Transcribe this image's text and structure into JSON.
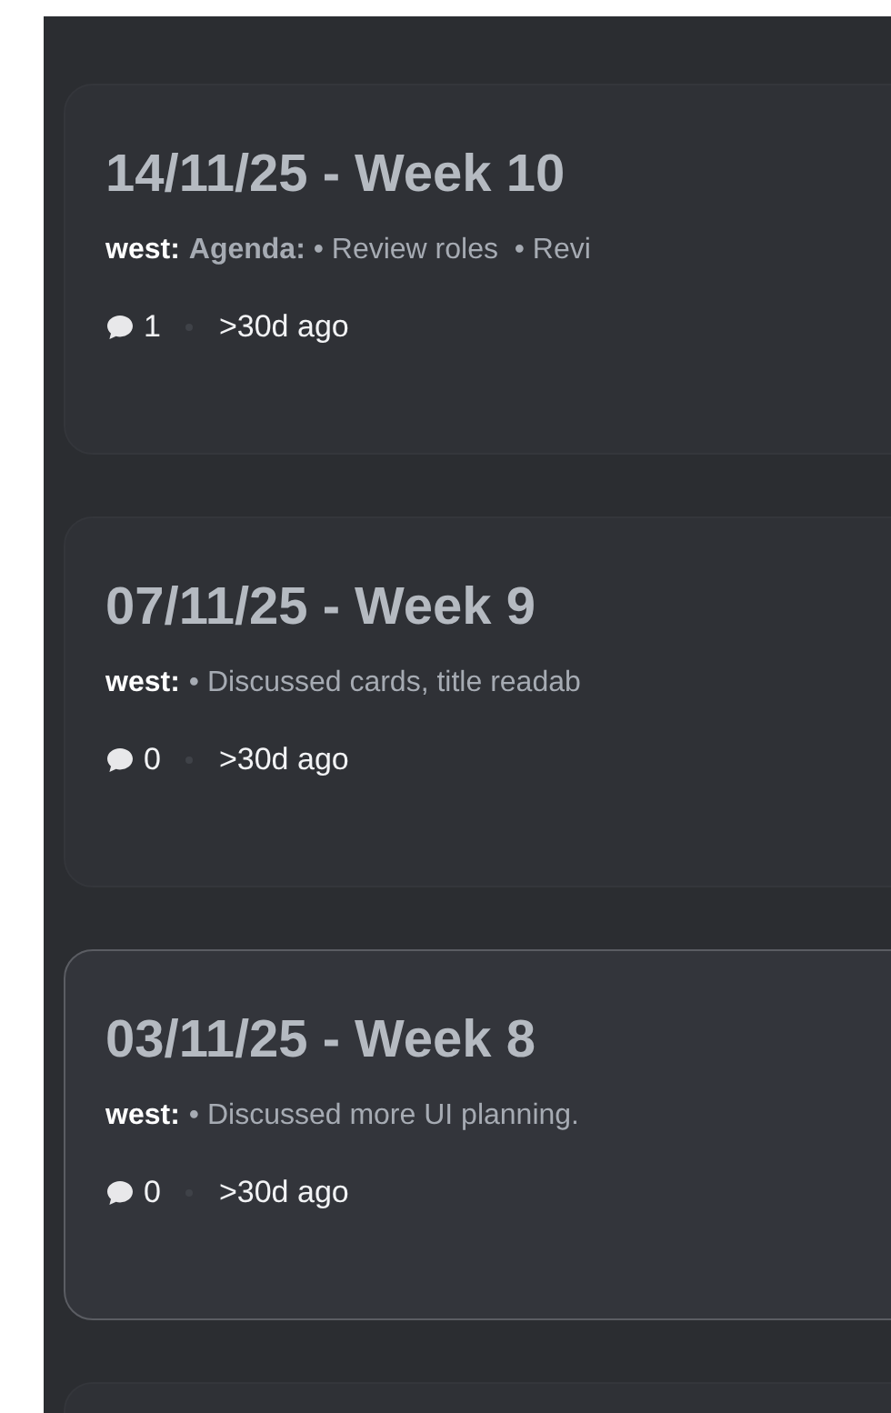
{
  "posts": [
    {
      "title": "14/11/25 - Week 10",
      "author": "west:",
      "preview": "**Agenda:** • Review roles  • Revi",
      "comments": "1",
      "age": ">30d ago",
      "hovered": false
    },
    {
      "title": "07/11/25 - Week 9",
      "author": "west:",
      "preview": "• Discussed cards, title readab",
      "comments": "0",
      "age": ">30d ago",
      "hovered": false
    },
    {
      "title": "03/11/25 - Week 8",
      "author": "west:",
      "preview": "• Discussed more UI planning.",
      "comments": "0",
      "age": ">30d ago",
      "hovered": true
    }
  ]
}
